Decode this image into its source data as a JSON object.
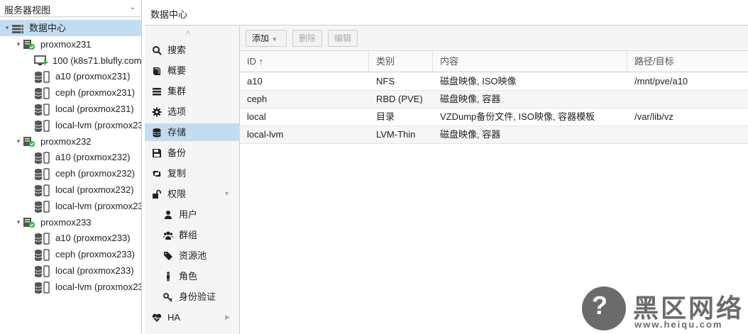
{
  "tree": {
    "view_label": "服务器视图",
    "rows": [
      {
        "label": "数据中心",
        "kind": "datacenter",
        "indent": 0,
        "expanded": true,
        "selected": true
      },
      {
        "label": "proxmox231",
        "kind": "node",
        "indent": 1,
        "expanded": true
      },
      {
        "label": "100 (k8s71.blufly.com",
        "kind": "vm",
        "indent": 2
      },
      {
        "label": "a10 (proxmox231)",
        "kind": "storage",
        "indent": 2
      },
      {
        "label": "ceph (proxmox231)",
        "kind": "storage",
        "indent": 2
      },
      {
        "label": "local (proxmox231)",
        "kind": "storage",
        "indent": 2
      },
      {
        "label": "local-lvm (proxmox23",
        "kind": "storage",
        "indent": 2
      },
      {
        "label": "proxmox232",
        "kind": "node",
        "indent": 1,
        "expanded": true
      },
      {
        "label": "a10 (proxmox232)",
        "kind": "storage",
        "indent": 2
      },
      {
        "label": "ceph (proxmox232)",
        "kind": "storage",
        "indent": 2
      },
      {
        "label": "local (proxmox232)",
        "kind": "storage",
        "indent": 2
      },
      {
        "label": "local-lvm (proxmox23",
        "kind": "storage",
        "indent": 2
      },
      {
        "label": "proxmox233",
        "kind": "node",
        "indent": 1,
        "expanded": true
      },
      {
        "label": "a10 (proxmox233)",
        "kind": "storage",
        "indent": 2
      },
      {
        "label": "ceph (proxmox233)",
        "kind": "storage",
        "indent": 2
      },
      {
        "label": "local (proxmox233)",
        "kind": "storage",
        "indent": 2
      },
      {
        "label": "local-lvm (proxmox23",
        "kind": "storage",
        "indent": 2
      }
    ]
  },
  "header": {
    "title": "数据中心"
  },
  "nav": {
    "items": [
      {
        "label": "搜索",
        "icon": "search-icon",
        "sub": false
      },
      {
        "label": "概要",
        "icon": "book-icon",
        "sub": false
      },
      {
        "label": "集群",
        "icon": "server-icon",
        "sub": false
      },
      {
        "label": "选项",
        "icon": "gear-icon",
        "sub": false
      },
      {
        "label": "存储",
        "icon": "database-icon",
        "sub": false,
        "active": true
      },
      {
        "label": "备份",
        "icon": "floppy-icon",
        "sub": false
      },
      {
        "label": "复制",
        "icon": "retweet-icon",
        "sub": false
      },
      {
        "label": "权限",
        "icon": "unlock-icon",
        "sub": false,
        "expandable": "down"
      },
      {
        "label": "用户",
        "icon": "user-icon",
        "sub": true
      },
      {
        "label": "群组",
        "icon": "users-icon",
        "sub": true
      },
      {
        "label": "资源池",
        "icon": "tags-icon",
        "sub": true
      },
      {
        "label": "角色",
        "icon": "male-icon",
        "sub": true
      },
      {
        "label": "身份验证",
        "icon": "key-icon",
        "sub": true
      },
      {
        "label": "HA",
        "icon": "heartbeat-icon",
        "sub": false,
        "expandable": "right"
      }
    ]
  },
  "toolbar": {
    "add_label": "添加",
    "remove_label": "删除",
    "edit_label": "编辑"
  },
  "grid": {
    "columns": [
      "ID ↑",
      "类别",
      "内容",
      "路径/目标"
    ],
    "rows": [
      [
        "a10",
        "NFS",
        "磁盘映像, ISO映像",
        "/mnt/pve/a10"
      ],
      [
        "ceph",
        "RBD (PVE)",
        "磁盘映像, 容器",
        ""
      ],
      [
        "local",
        "目录",
        "VZDump备份文件, ISO映像, 容器模板",
        "/var/lib/vz"
      ],
      [
        "local-lvm",
        "LVM-Thin",
        "磁盘映像, 容器",
        ""
      ]
    ]
  },
  "watermark": {
    "title": "黑区网络",
    "url": "www.heiqu.com"
  },
  "colors": {
    "selected": "#c2ddf2",
    "node_ok": "#2fbd3c",
    "vm_running": "#2fbd3c",
    "watermark": "#6b6b6b"
  }
}
